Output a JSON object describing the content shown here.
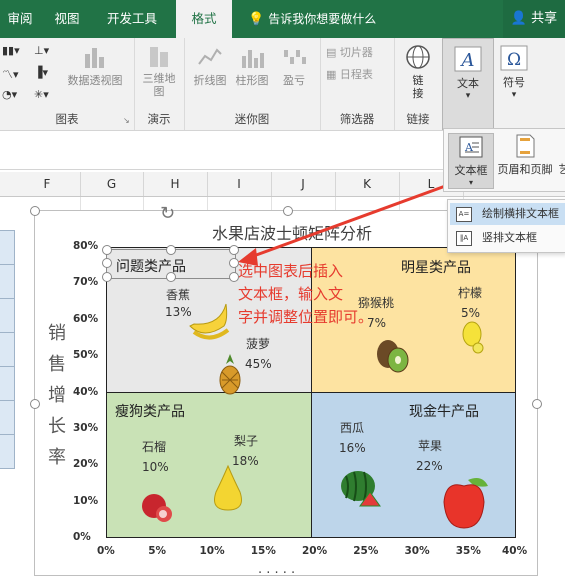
{
  "ribbon": {
    "tabs": [
      "审阅",
      "视图",
      "开发工具",
      "格式"
    ],
    "active_tab": "格式",
    "tell_me": "告诉我你想要做什么",
    "share": "共享",
    "buttons": {
      "pivot_chart": "数据透视图",
      "map_3d": "三维地",
      "map_3d_2": "图",
      "line": "折线图",
      "column": "柱形图",
      "winloss": "盈亏",
      "slicer": "切片器",
      "timeline": "日程表",
      "link": "链",
      "link_2": "接",
      "text": "文本",
      "symbol": "符号"
    },
    "groups": {
      "charts": "图表",
      "tours": "演示",
      "sparklines": "迷你图",
      "filters": "筛选器",
      "links": "链接"
    }
  },
  "dropdown": {
    "items": [
      "文本框",
      "页眉和页脚",
      "艺"
    ],
    "submenu": [
      "绘制横排文本框",
      "竖排文本框"
    ]
  },
  "sheet": {
    "columns": [
      "F",
      "G",
      "H",
      "I",
      "J",
      "K",
      "L"
    ]
  },
  "chart_data": {
    "type": "scatter",
    "title": "水果店波士顿矩阵分析",
    "ylabel": [
      "销",
      "售",
      "增",
      "长",
      "率"
    ],
    "x_ticks": [
      "0%",
      "5%",
      "10%",
      "15%",
      "20%",
      "25%",
      "30%",
      "35%",
      "40%"
    ],
    "y_ticks": [
      "80%",
      "70%",
      "60%",
      "50%",
      "40%",
      "30%",
      "20%",
      "10%",
      "0%"
    ],
    "xlim": [
      0,
      0.4
    ],
    "ylim": [
      0,
      0.8
    ],
    "quadrants": [
      {
        "name": "问题类产品",
        "color": "#e8e8e8"
      },
      {
        "name": "明星类产品",
        "color": "#fde3a1"
      },
      {
        "name": "瘦狗类产品",
        "color": "#c9e2b6"
      },
      {
        "name": "现金牛产品",
        "color": "#bdd5ea"
      }
    ],
    "points": [
      {
        "name": "香蕉",
        "label": "13%",
        "icon": "banana-icon"
      },
      {
        "name": "菠萝",
        "label": "45%",
        "icon": "pineapple-icon"
      },
      {
        "name": "猕猴桃",
        "label": "7%",
        "icon": "kiwi-icon"
      },
      {
        "name": "柠檬",
        "label": "5%",
        "icon": "lemon-icon"
      },
      {
        "name": "石榴",
        "label": "10%",
        "icon": "pomegranate-icon"
      },
      {
        "name": "梨子",
        "label": "18%",
        "icon": "pear-icon"
      },
      {
        "name": "西瓜",
        "label": "16%",
        "icon": "watermelon-icon"
      },
      {
        "name": "苹果",
        "label": "22%",
        "icon": "apple-icon"
      }
    ]
  },
  "annotation": [
    "选中图表后插入",
    "文本框，输入文",
    "字并调整位置即可。"
  ],
  "textbox_text": "问题类产品",
  "colors": {
    "ribbon_green": "#217346",
    "annotation_red": "#e63b2e",
    "arrow_red": "#e63b2e"
  }
}
